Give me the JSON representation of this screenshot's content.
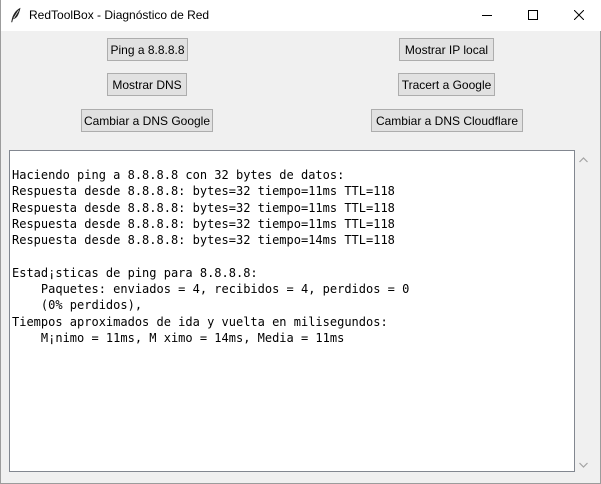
{
  "window": {
    "title": "RedToolBox - Diagnóstico de Red",
    "app_icon": "feather-icon"
  },
  "buttons": {
    "ping": "Ping a 8.8.8.8",
    "show_ip": "Mostrar IP local",
    "show_dns": "Mostrar DNS",
    "tracert": "Tracert a Google",
    "dns_google": "Cambiar a DNS Google",
    "dns_cloudflare": "Cambiar a DNS Cloudflare"
  },
  "output": {
    "lines": [
      "Haciendo ping a 8.8.8.8 con 32 bytes de datos:",
      "Respuesta desde 8.8.8.8: bytes=32 tiempo=11ms TTL=118",
      "Respuesta desde 8.8.8.8: bytes=32 tiempo=11ms TTL=118",
      "Respuesta desde 8.8.8.8: bytes=32 tiempo=11ms TTL=118",
      "Respuesta desde 8.8.8.8: bytes=32 tiempo=14ms TTL=118",
      "",
      "Estad¡sticas de ping para 8.8.8.8:",
      "    Paquetes: enviados = 4, recibidos = 4, perdidos = 0",
      "    (0% perdidos),",
      "Tiempos aproximados de ida y vuelta en milisegundos:",
      "    M¡nimo = 11ms, M ximo = 14ms, Media = 11ms"
    ]
  },
  "icons": {
    "minimize": "minimize-icon",
    "maximize": "maximize-icon",
    "close": "close-icon",
    "scroll_up": "chevron-up-icon",
    "scroll_down": "chevron-down-icon"
  }
}
